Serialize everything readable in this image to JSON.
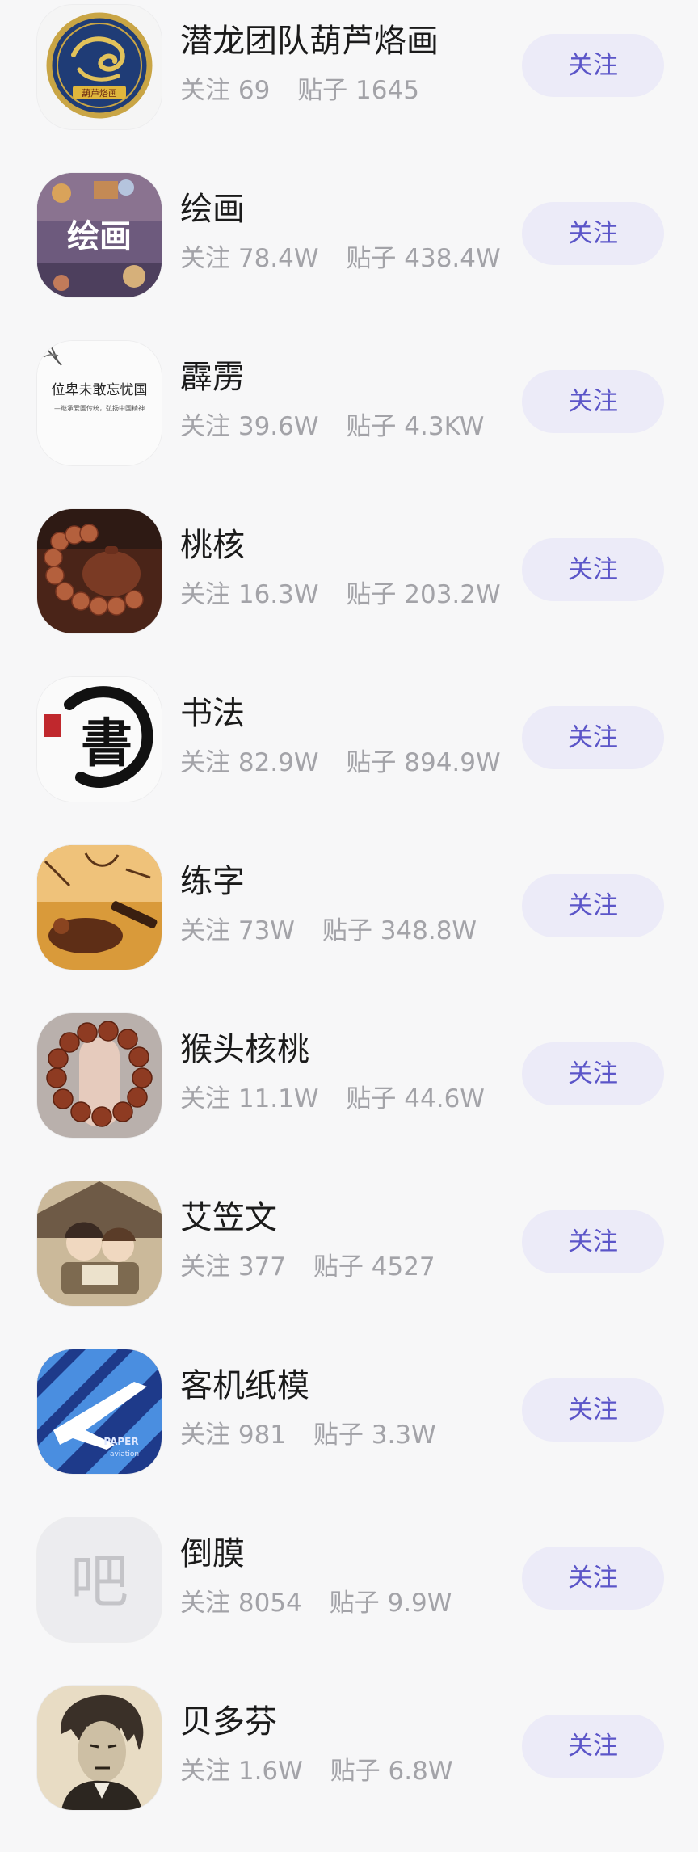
{
  "labels": {
    "follow_prefix": "关注",
    "posts_prefix": "贴子"
  },
  "communities": [
    {
      "name": "潜龙团队葫芦烙画",
      "followers": "69",
      "posts": "1645",
      "button": "关注",
      "icon": "dragon-emblem-icon",
      "brand_text": "葫芦烙画"
    },
    {
      "name": "绘画",
      "followers": "78.4W",
      "posts": "438.4W",
      "button": "关注",
      "icon": "painting-collage-icon",
      "brand_text": "绘画"
    },
    {
      "name": "霹雳",
      "followers": "39.6W",
      "posts": "4.3KW",
      "button": "关注",
      "icon": "calligraphy-banner-icon",
      "brand_text": "位卑未敢忘忧国",
      "brand_subtext": "—继承爱国传统，弘扬中国精神"
    },
    {
      "name": "桃核",
      "followers": "16.3W",
      "posts": "203.2W",
      "button": "关注",
      "icon": "bead-teapot-icon"
    },
    {
      "name": "书法",
      "followers": "82.9W",
      "posts": "894.9W",
      "button": "关注",
      "icon": "calligraphy-brush-icon",
      "brand_text": "書"
    },
    {
      "name": "练字",
      "followers": "73W",
      "posts": "348.8W",
      "button": "关注",
      "icon": "ink-writing-icon"
    },
    {
      "name": "猴头核桃",
      "followers": "11.1W",
      "posts": "44.6W",
      "button": "关注",
      "icon": "bead-bracelet-icon"
    },
    {
      "name": "艾笠文",
      "followers": "377",
      "posts": "4527",
      "button": "关注",
      "icon": "anime-characters-icon"
    },
    {
      "name": "客机纸模",
      "followers": "981",
      "posts": "3.3W",
      "button": "关注",
      "icon": "paper-airplane-icon",
      "brand_text": "PAPER",
      "brand_subtext": "aviation"
    },
    {
      "name": "倒膜",
      "followers": "8054",
      "posts": "9.9W",
      "button": "关注",
      "icon": "default-bar-icon",
      "brand_text": "吧"
    },
    {
      "name": "贝多芬",
      "followers": "1.6W",
      "posts": "6.8W",
      "button": "关注",
      "icon": "beethoven-portrait-icon"
    }
  ],
  "colors": {
    "background": "#f7f7f8",
    "follow_button_bg": "#ecebf8",
    "follow_button_text": "#5b55c8",
    "name_text": "#1b1b1b",
    "stats_text": "#a3a3a8"
  }
}
